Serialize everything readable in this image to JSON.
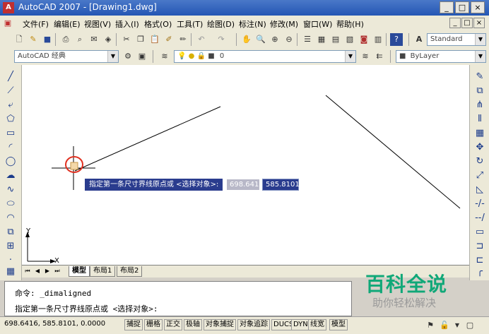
{
  "window": {
    "title": "AutoCAD 2007 - [Drawing1.dwg]",
    "app_icon": "autocad-logo-icon",
    "controls": [
      "_",
      "□",
      "×"
    ]
  },
  "menubar": {
    "items": [
      "文件(F)",
      "编辑(E)",
      "视图(V)",
      "插入(I)",
      "格式(O)",
      "工具(T)",
      "绘图(D)",
      "标注(N)",
      "修改(M)",
      "窗口(W)",
      "帮助(H)"
    ],
    "mdi_controls": [
      "_",
      "□",
      "×"
    ]
  },
  "toolbar": {
    "text_style": "Standard",
    "workspace": "AutoCAD 经典",
    "layer": "0",
    "linetype": "ByLayer"
  },
  "drawing": {
    "ucs_x_label": "X",
    "ucs_y_label": "Y",
    "dynamic_prompt": "指定第一条尺寸界线原点或 <选择对象>:",
    "input_x": "698.6416",
    "input_y": "585.8101"
  },
  "tabs": {
    "items": [
      "模型",
      "布局1",
      "布局2"
    ],
    "active": "模型"
  },
  "command": {
    "line1": "命令: _dimaligned",
    "line2": "指定第一条尺寸界线原点或 <选择对象>:"
  },
  "status": {
    "coords": "698.6416, 585.8101, 0.0000",
    "toggles": [
      "捕捉",
      "栅格",
      "正交",
      "极轴",
      "对象捕捉",
      "对象追踪",
      "DUCS",
      "DYN",
      "线宽",
      "模型"
    ]
  },
  "watermark": {
    "main": "百科全说",
    "sub": "助你轻松解决"
  },
  "colors": {
    "title_bar": "#2456b4",
    "tooltip_bg": "#2a3c8e",
    "highlight_circle": "#e03020",
    "watermark": "#10a878"
  }
}
